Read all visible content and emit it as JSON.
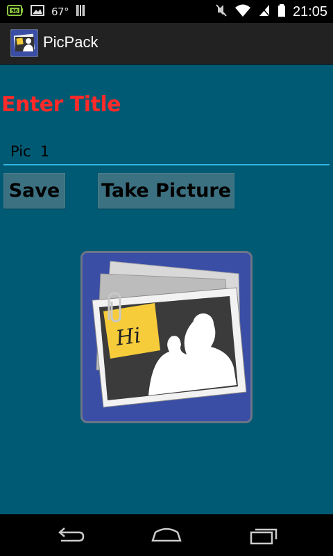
{
  "status_bar": {
    "temperature": "67°",
    "time": "21:05",
    "icons": [
      "battery-app-icon",
      "image-icon",
      "barcode-icon",
      "mute-icon",
      "wifi-icon",
      "signal-icon",
      "battery-icon"
    ]
  },
  "action_bar": {
    "title": "PicPack",
    "icon": "picpack-app-icon"
  },
  "main": {
    "heading": "Enter Title",
    "title_input_value": "Pic  1",
    "save_label": "Save",
    "take_picture_label": "Take Picture",
    "preview_sticky_note_text": "Hi"
  },
  "nav_bar": {
    "icons": [
      "back-icon",
      "home-icon",
      "recent-apps-icon"
    ]
  },
  "colors": {
    "background": "#005a73",
    "heading": "#ff2a2a",
    "input_underline": "#33b5e5",
    "button": "#3c7181",
    "frame": "#3a4ea6"
  }
}
